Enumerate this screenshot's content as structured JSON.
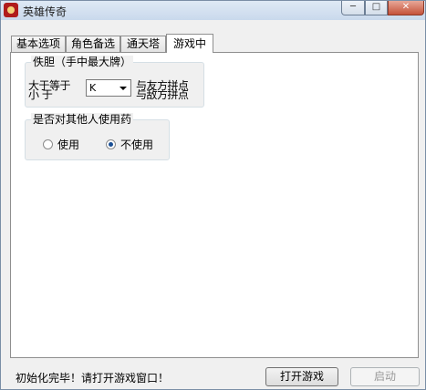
{
  "window": {
    "title": "英雄传奇"
  },
  "title_buttons": {
    "minimize": "─",
    "maximize": "□",
    "close": "✕"
  },
  "tabs": [
    {
      "label": "基本选项"
    },
    {
      "label": "角色备选"
    },
    {
      "label": "通天塔"
    },
    {
      "label": "游戏中"
    }
  ],
  "group_timid": {
    "title": "佚胆（手中最大牌）",
    "left_top": "大于等于",
    "left_bottom": "小     于",
    "combo_value": "K",
    "right_top": "与友方拼点",
    "right_bottom": "与敌方拼点"
  },
  "group_medicine": {
    "title": "是否对其他人使用药",
    "option_use": "使用",
    "option_no_use": "不使用",
    "selected": "不使用"
  },
  "footer": {
    "status": "初始化完毕！请打开游戏窗口！",
    "open_game_button": "打开游戏",
    "start_button": "启动"
  }
}
